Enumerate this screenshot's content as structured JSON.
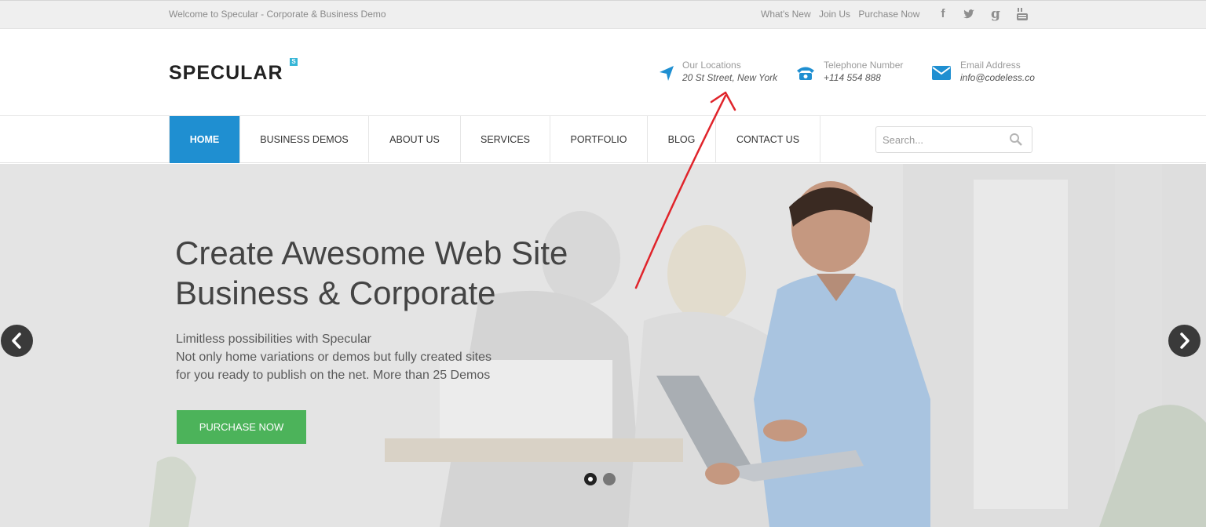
{
  "topbar": {
    "welcome": "Welcome to Specular - Corporate & Business Demo",
    "links": [
      "What's New",
      "Join Us",
      "Purchase Now"
    ],
    "social": [
      "facebook-icon",
      "twitter-icon",
      "google-plus-icon",
      "youtube-icon"
    ]
  },
  "header": {
    "logo": "SPECULAR",
    "logo_badge": "S",
    "location": {
      "label": "Our Locations",
      "value": "20 St Street, New York",
      "icon": "location-arrow-icon"
    },
    "phone": {
      "label": "Telephone Number",
      "value": "+114 554 888",
      "icon": "phone-icon"
    },
    "email": {
      "label": "Email Address",
      "value": "info@codeless.co",
      "icon": "envelope-icon"
    }
  },
  "nav": {
    "items": [
      "HOME",
      "BUSINESS DEMOS",
      "ABOUT US",
      "SERVICES",
      "PORTFOLIO",
      "BLOG",
      "CONTACT US"
    ],
    "active": "HOME",
    "search_placeholder": "Search..."
  },
  "hero": {
    "title_line1": "Create Awesome Web Site",
    "title_line2": "Business & Corporate",
    "sub_line1": "Limitless possibilities with Specular",
    "sub_line2": "Not only home variations or demos but fully created sites",
    "sub_line3": "for you ready to publish on the net. More than 25 Demos",
    "button": "PURCHASE NOW",
    "slides": 2,
    "active_slide": 1
  },
  "colors": {
    "accent_blue": "#1f8fd1",
    "button_green": "#4cb35a",
    "annotation_red": "#e0242b"
  }
}
